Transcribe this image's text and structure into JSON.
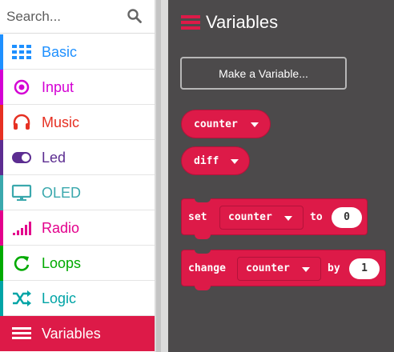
{
  "toolbox": {
    "search": {
      "placeholder": "Search..."
    },
    "categories": [
      {
        "label": "Basic",
        "icon": "grid-icon",
        "color": "#1e90ff"
      },
      {
        "label": "Input",
        "icon": "target-icon",
        "color": "#d400d4"
      },
      {
        "label": "Music",
        "icon": "headphones-icon",
        "color": "#e63022"
      },
      {
        "label": "Led",
        "icon": "toggle-icon",
        "color": "#5c2d91"
      },
      {
        "label": "OLED",
        "icon": "monitor-icon",
        "color": "#3aa8ad"
      },
      {
        "label": "Radio",
        "icon": "signal-bars-icon",
        "color": "#e3008c"
      },
      {
        "label": "Loops",
        "icon": "refresh-icon",
        "color": "#00aa00"
      },
      {
        "label": "Logic",
        "icon": "shuffle-icon",
        "color": "#00a4a6"
      },
      {
        "label": "Variables",
        "icon": "list-icon",
        "color": "#dc143c",
        "selected": true
      }
    ]
  },
  "flyout": {
    "title": "Variables",
    "make_variable_label": "Make a Variable...",
    "reporters": [
      {
        "name": "counter"
      },
      {
        "name": "diff"
      }
    ],
    "set_block": {
      "keyword": "set",
      "variable": "counter",
      "to": "to",
      "value": "0"
    },
    "change_block": {
      "keyword": "change",
      "variable": "counter",
      "by": "by",
      "value": "1"
    }
  },
  "colors": {
    "variables_block": "#dd1a48",
    "workspace_bg": "#4c4a4b"
  }
}
